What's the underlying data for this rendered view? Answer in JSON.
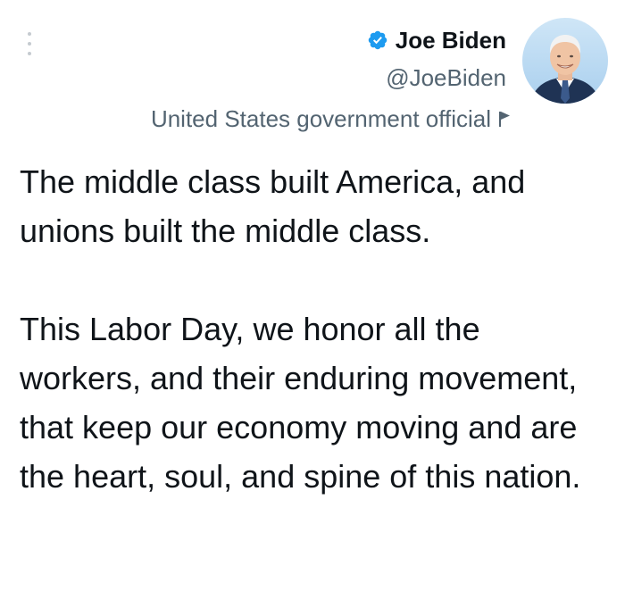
{
  "header": {
    "menu_icon": "vertical-ellipsis-icon",
    "avatar_icon": "profile-photo",
    "display_name": "Joe Biden",
    "verified_icon": "verified-badge-icon",
    "handle": "@JoeBiden",
    "account_label": "United States government official",
    "label_icon": "flag-icon"
  },
  "tweet": {
    "paragraph_1": "The middle class built America, and unions built the middle class.",
    "paragraph_2": "This Labor Day, we honor all the workers, and their enduring movement, that keep our economy moving and are the heart, soul, and spine of this nation."
  },
  "colors": {
    "verified_blue": "#1d9bf0",
    "text_primary": "#0f1419",
    "text_secondary": "#536471",
    "background": "#ffffff"
  }
}
